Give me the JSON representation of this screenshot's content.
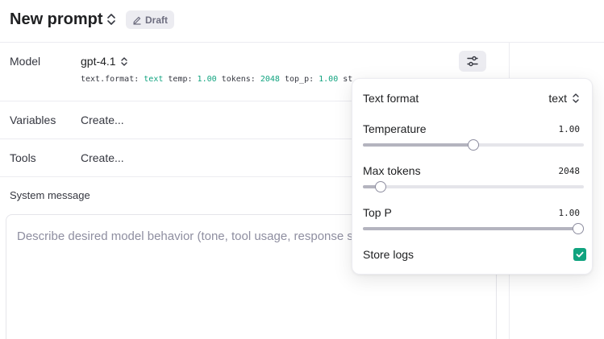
{
  "header": {
    "title": "New prompt",
    "badge": "Draft"
  },
  "rows": {
    "model": {
      "label": "Model",
      "value": "gpt-4.1"
    },
    "model_meta": [
      {
        "key": "text.format:",
        "value": "text"
      },
      {
        "key": "temp:",
        "value": "1.00"
      },
      {
        "key": "tokens:",
        "value": "2048"
      },
      {
        "key": "top_p:",
        "value": "1.00"
      },
      {
        "key": "st",
        "value": ""
      }
    ],
    "variables": {
      "label": "Variables",
      "value": "Create..."
    },
    "tools": {
      "label": "Tools",
      "value": "Create..."
    },
    "system": {
      "label": "System message",
      "placeholder": "Describe desired model behavior (tone, tool usage, response style)"
    }
  },
  "settings": {
    "text_format": {
      "label": "Text format",
      "value": "text"
    },
    "temperature": {
      "label": "Temperature",
      "value": "1.00",
      "level": 0.5
    },
    "max_tokens": {
      "label": "Max tokens",
      "value": "2048",
      "level": 0.08
    },
    "top_p": {
      "label": "Top P",
      "value": "1.00",
      "level": 1.0
    },
    "store_logs": {
      "label": "Store logs",
      "checked": true
    }
  },
  "colors": {
    "accent": "#10a37f",
    "text": "#202123",
    "muted": "#8e8ea0",
    "border": "#ececf1"
  },
  "icons": [
    "chevron-up-down-icon",
    "edit-icon",
    "sliders-icon",
    "checkmark-icon"
  ]
}
